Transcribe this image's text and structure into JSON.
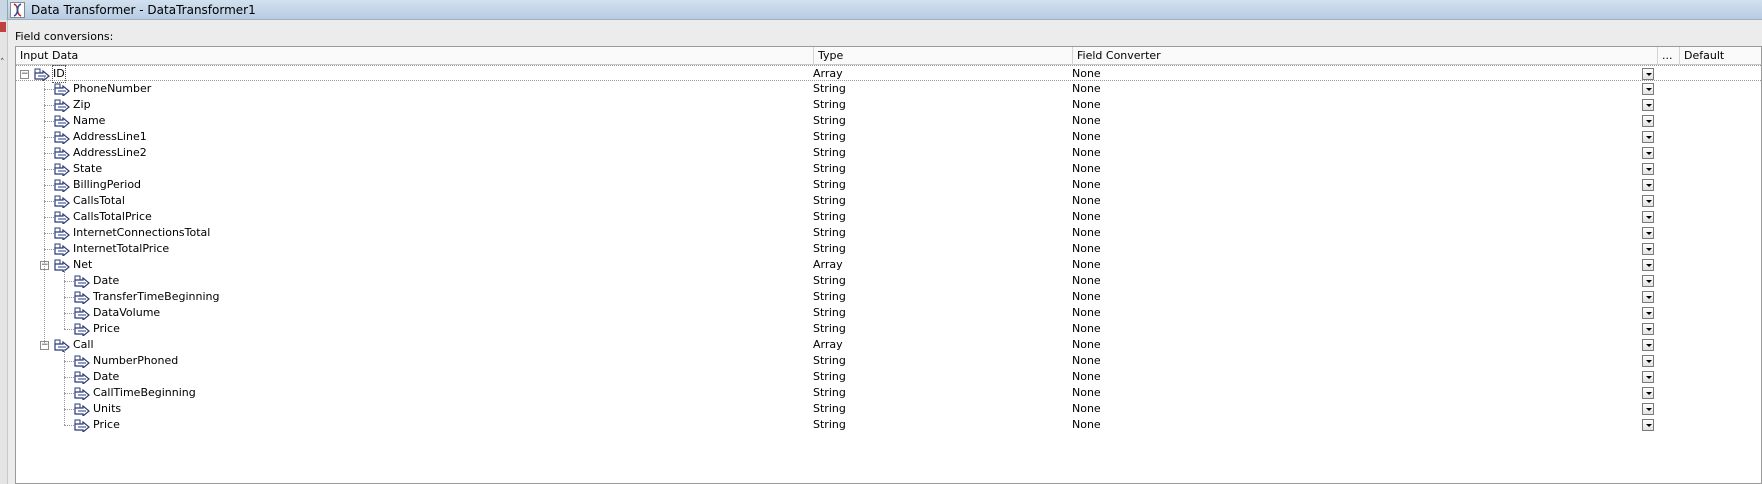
{
  "window": {
    "title": "Data Transformer - DataTransformer1"
  },
  "panel": {
    "label": "Field conversions:"
  },
  "columns": {
    "input_data": "Input Data",
    "type": "Type",
    "field_converter": "Field Converter",
    "more": "...",
    "default": "Default"
  },
  "rows": [
    {
      "name": "ID",
      "type": "Array",
      "converter": "None",
      "level": 0,
      "expandable": true,
      "selected": true
    },
    {
      "name": "PhoneNumber",
      "type": "String",
      "converter": "None",
      "level": 1
    },
    {
      "name": "Zip",
      "type": "String",
      "converter": "None",
      "level": 1
    },
    {
      "name": "Name",
      "type": "String",
      "converter": "None",
      "level": 1
    },
    {
      "name": "AddressLine1",
      "type": "String",
      "converter": "None",
      "level": 1
    },
    {
      "name": "AddressLine2",
      "type": "String",
      "converter": "None",
      "level": 1
    },
    {
      "name": "State",
      "type": "String",
      "converter": "None",
      "level": 1
    },
    {
      "name": "BillingPeriod",
      "type": "String",
      "converter": "None",
      "level": 1
    },
    {
      "name": "CallsTotal",
      "type": "String",
      "converter": "None",
      "level": 1
    },
    {
      "name": "CallsTotalPrice",
      "type": "String",
      "converter": "None",
      "level": 1
    },
    {
      "name": "InternetConnectionsTotal",
      "type": "String",
      "converter": "None",
      "level": 1
    },
    {
      "name": "InternetTotalPrice",
      "type": "String",
      "converter": "None",
      "level": 1
    },
    {
      "name": "Net",
      "type": "Array",
      "converter": "None",
      "level": 1,
      "expandable": true
    },
    {
      "name": "Date",
      "type": "String",
      "converter": "None",
      "level": 2
    },
    {
      "name": "TransferTimeBeginning",
      "type": "String",
      "converter": "None",
      "level": 2
    },
    {
      "name": "DataVolume",
      "type": "String",
      "converter": "None",
      "level": 2
    },
    {
      "name": "Price",
      "type": "String",
      "converter": "None",
      "level": 2
    },
    {
      "name": "Call",
      "type": "Array",
      "converter": "None",
      "level": 1,
      "expandable": true
    },
    {
      "name": "NumberPhoned",
      "type": "String",
      "converter": "None",
      "level": 2
    },
    {
      "name": "Date",
      "type": "String",
      "converter": "None",
      "level": 2
    },
    {
      "name": "CallTimeBeginning",
      "type": "String",
      "converter": "None",
      "level": 2
    },
    {
      "name": "Units",
      "type": "String",
      "converter": "None",
      "level": 2
    },
    {
      "name": "Price",
      "type": "String",
      "converter": "None",
      "level": 2
    }
  ]
}
